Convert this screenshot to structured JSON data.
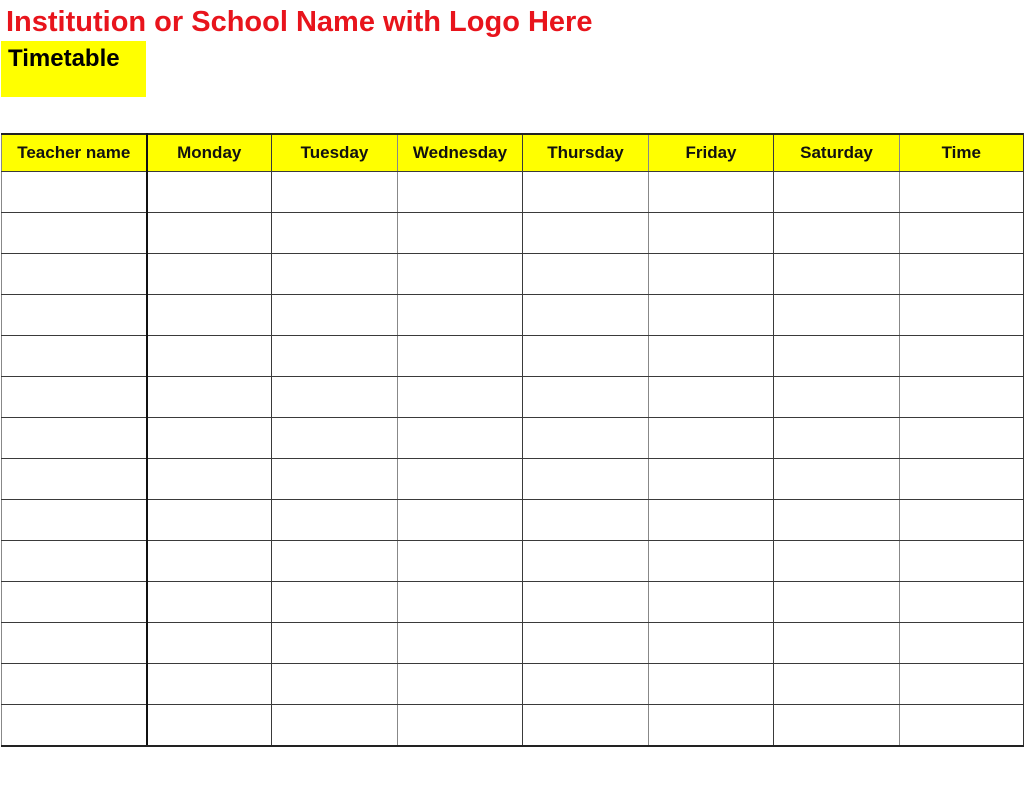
{
  "header": {
    "title": "Institution or School Name with Logo Here",
    "subtitle": "Timetable",
    "title_color": "#e8141c",
    "highlight_color": "#ffff00"
  },
  "table": {
    "columns": [
      "Teacher name",
      "Monday",
      "Tuesday",
      "Wednesday",
      "Thursday",
      "Friday",
      "Saturday",
      "Time"
    ],
    "row_count": 14,
    "rows": [
      [
        "",
        "",
        "",
        "",
        "",
        "",
        "",
        ""
      ],
      [
        "",
        "",
        "",
        "",
        "",
        "",
        "",
        ""
      ],
      [
        "",
        "",
        "",
        "",
        "",
        "",
        "",
        ""
      ],
      [
        "",
        "",
        "",
        "",
        "",
        "",
        "",
        ""
      ],
      [
        "",
        "",
        "",
        "",
        "",
        "",
        "",
        ""
      ],
      [
        "",
        "",
        "",
        "",
        "",
        "",
        "",
        ""
      ],
      [
        "",
        "",
        "",
        "",
        "",
        "",
        "",
        ""
      ],
      [
        "",
        "",
        "",
        "",
        "",
        "",
        "",
        ""
      ],
      [
        "",
        "",
        "",
        "",
        "",
        "",
        "",
        ""
      ],
      [
        "",
        "",
        "",
        "",
        "",
        "",
        "",
        ""
      ],
      [
        "",
        "",
        "",
        "",
        "",
        "",
        "",
        ""
      ],
      [
        "",
        "",
        "",
        "",
        "",
        "",
        "",
        ""
      ],
      [
        "",
        "",
        "",
        "",
        "",
        "",
        "",
        ""
      ],
      [
        "",
        "",
        "",
        "",
        "",
        "",
        "",
        ""
      ]
    ]
  }
}
